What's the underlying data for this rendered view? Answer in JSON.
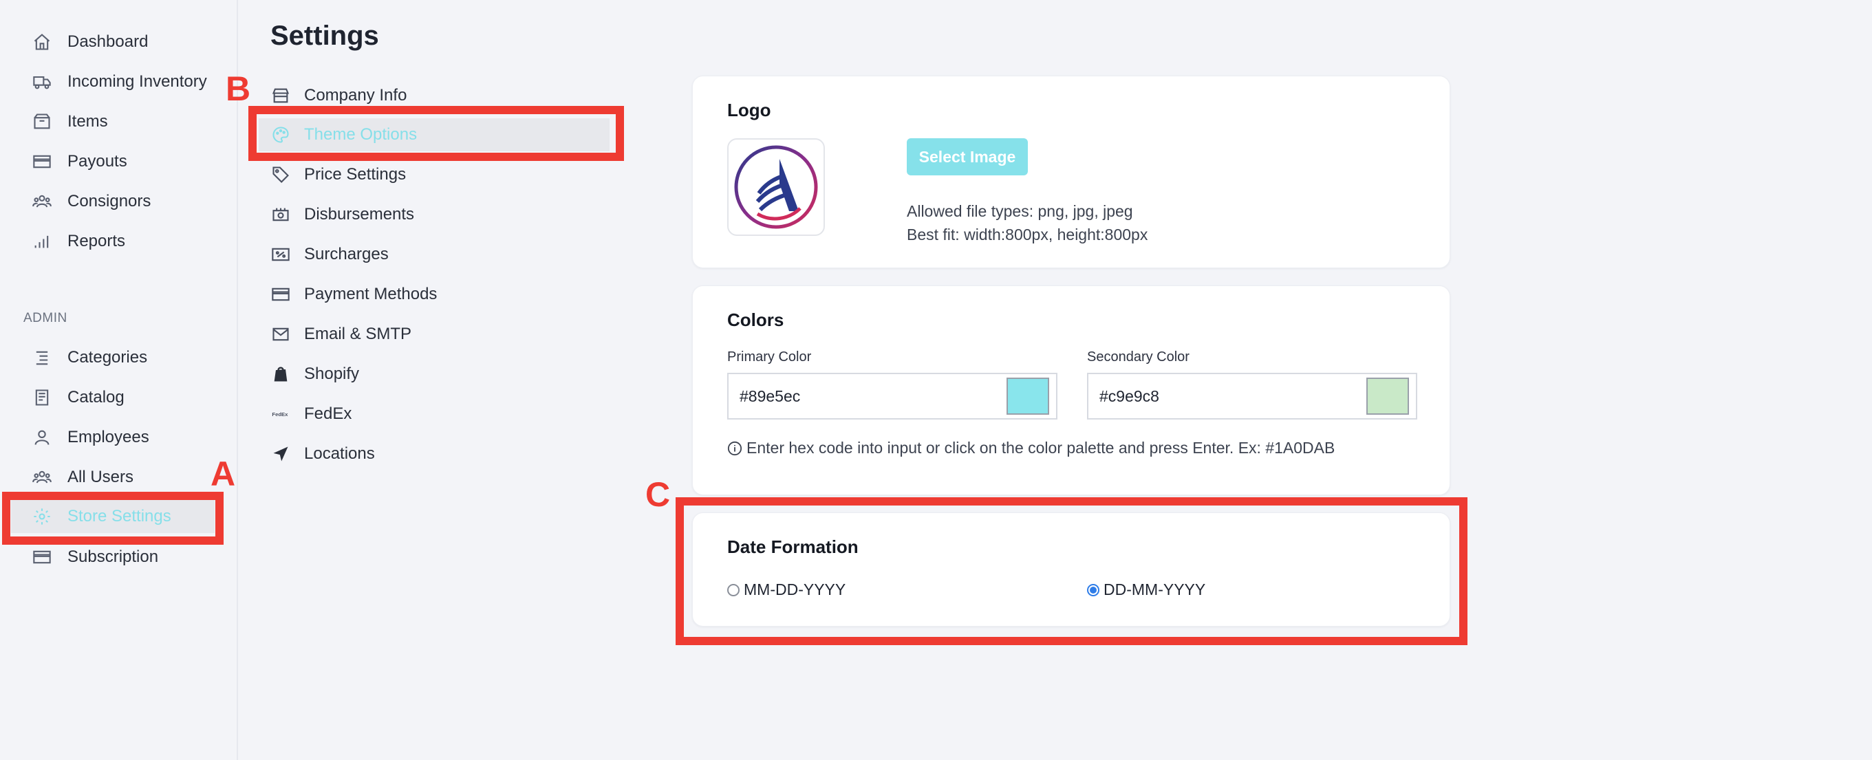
{
  "sidebar": {
    "items": [
      {
        "label": "Dashboard",
        "icon": "home-icon"
      },
      {
        "label": "Incoming Inventory",
        "icon": "truck-icon"
      },
      {
        "label": "Items",
        "icon": "box-icon"
      },
      {
        "label": "Payouts",
        "icon": "card-icon"
      },
      {
        "label": "Consignors",
        "icon": "users-icon"
      },
      {
        "label": "Reports",
        "icon": "bars-icon"
      }
    ],
    "admin_label": "ADMIN",
    "admin_items": [
      {
        "label": "Categories",
        "icon": "list-icon"
      },
      {
        "label": "Catalog",
        "icon": "catalog-icon"
      },
      {
        "label": "Employees",
        "icon": "user-icon"
      },
      {
        "label": "All Users",
        "icon": "users-icon"
      },
      {
        "label": "Store Settings",
        "icon": "gear-icon",
        "active": true
      },
      {
        "label": "Subscription",
        "icon": "card-icon"
      }
    ]
  },
  "page": {
    "title": "Settings"
  },
  "settings_menu": [
    {
      "label": "Company Info",
      "icon": "store-icon"
    },
    {
      "label": "Theme Options",
      "icon": "palette-icon",
      "active": true
    },
    {
      "label": "Price Settings",
      "icon": "tag-icon"
    },
    {
      "label": "Disbursements",
      "icon": "cash-icon"
    },
    {
      "label": "Surcharges",
      "icon": "percent-icon"
    },
    {
      "label": "Payment Methods",
      "icon": "card-icon"
    },
    {
      "label": "Email & SMTP",
      "icon": "mail-icon"
    },
    {
      "label": "Shopify",
      "icon": "shopify-icon"
    },
    {
      "label": "FedEx",
      "icon": "fedex-icon"
    },
    {
      "label": "Locations",
      "icon": "location-arrow-icon"
    }
  ],
  "logo_card": {
    "title": "Logo",
    "button": "Select Image",
    "hint_types": "Allowed file types: png, jpg, jpeg",
    "hint_size": "Best fit: width:800px, height:800px"
  },
  "colors_card": {
    "title": "Colors",
    "primary_label": "Primary Color",
    "primary_value": "#89e5ec",
    "secondary_label": "Secondary Color",
    "secondary_value": "#c9e9c8",
    "info": "Enter hex code into input or click on the color palette and press Enter. Ex: #1A0DAB"
  },
  "date_card": {
    "title": "Date Formation",
    "option_a": "MM-DD-YYYY",
    "option_b": "DD-MM-YYYY",
    "selected": "DD-MM-YYYY"
  },
  "annotations": {
    "a": "A",
    "b": "B",
    "c": "C"
  },
  "colors": {
    "accent": "#86dfe9",
    "highlight": "#ee3b32",
    "radio_checked": "#2f7de8"
  }
}
